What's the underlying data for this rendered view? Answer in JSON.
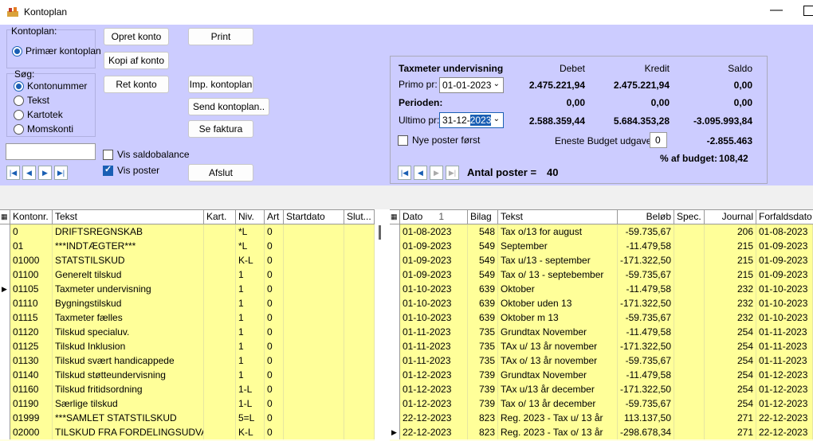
{
  "window": {
    "title": "Kontoplan"
  },
  "left_panel": {
    "kontoplan_label": "Kontoplan:",
    "kontoplan_option": "Primær kontoplan",
    "search_label": "Søg:",
    "search_options": [
      "Kontonummer",
      "Tekst",
      "Kartotek",
      "Momskonti"
    ],
    "vis_saldobalance": "Vis saldobalance",
    "vis_poster": "Vis poster"
  },
  "buttons": {
    "opret": "Opret konto",
    "kopi": "Kopi af konto",
    "ret": "Ret konto",
    "print": "Print",
    "imp": "Imp. kontoplan",
    "send": "Send kontoplan..",
    "faktura": "Se faktura",
    "afslut": "Afslut"
  },
  "info": {
    "title": "Taxmeter undervisning",
    "col_debet": "Debet",
    "col_kredit": "Kredit",
    "col_saldo": "Saldo",
    "primo_label": "Primo pr:",
    "primo_date": "01-01-2023",
    "primo_debet": "2.475.221,94",
    "primo_kredit": "2.475.221,94",
    "primo_saldo": "0,00",
    "perioden_label": "Perioden:",
    "perioden_debet": "0,00",
    "perioden_kredit": "0,00",
    "perioden_saldo": "0,00",
    "ultimo_label": "Ultimo pr:",
    "ultimo_date_a": "31-12-",
    "ultimo_date_b": "2023",
    "ultimo_debet": "2.588.359,44",
    "ultimo_kredit": "5.684.353,28",
    "ultimo_saldo": "-3.095.993,84",
    "nye_poster": "Nye poster først",
    "budget_label": "Eneste Budget udgave:",
    "budget_value": "0",
    "budget_amount": "-2.855.463",
    "pct_label": "% af budget:",
    "pct_value": "108,42",
    "antal_label": "Antal poster =",
    "antal_value": "40"
  },
  "accounts_table": {
    "headers": [
      "Kontonr.",
      "Tekst",
      "Kart.",
      "Niv.",
      "Art",
      "Startdato",
      "Slut..."
    ],
    "rows": [
      [
        "0",
        "DRIFTSREGNSKAB",
        "",
        "*L",
        "0",
        "",
        ""
      ],
      [
        "01",
        "***INDTÆGTER***",
        "",
        "*L",
        "0",
        "",
        ""
      ],
      [
        "01000",
        "STATSTILSKUD",
        "",
        "K-L",
        "0",
        "",
        ""
      ],
      [
        "01100",
        "Generelt tilskud",
        "",
        "1",
        "0",
        "",
        ""
      ],
      [
        "01105",
        "Taxmeter undervisning",
        "",
        "1",
        "0",
        "",
        ""
      ],
      [
        "01110",
        "Bygningstilskud",
        "",
        "1",
        "0",
        "",
        ""
      ],
      [
        "01115",
        "Taxmeter fælles",
        "",
        "1",
        "0",
        "",
        ""
      ],
      [
        "01120",
        "Tilskud specialuv.",
        "",
        "1",
        "0",
        "",
        ""
      ],
      [
        "01125",
        "Tilskud Inklusion",
        "",
        "1",
        "0",
        "",
        ""
      ],
      [
        "01130",
        "Tilskud svært handicappede",
        "",
        "1",
        "0",
        "",
        ""
      ],
      [
        "01140",
        "Tilskud støtteundervisning",
        "",
        "1",
        "0",
        "",
        ""
      ],
      [
        "01160",
        "Tilskud fritidsordning",
        "",
        "1-L",
        "0",
        "",
        ""
      ],
      [
        "01190",
        "Særlige tilskud",
        "",
        "1-L",
        "0",
        "",
        ""
      ],
      [
        "01999",
        "***SAMLET STATSTILSKUD",
        "",
        "5=L",
        "0",
        "",
        ""
      ],
      [
        "02000",
        "TILSKUD FRA FORDELINGSUDVAL...",
        "",
        "K-L",
        "0",
        "",
        ""
      ]
    ]
  },
  "postings_table": {
    "headers": [
      "Dato",
      "Bilag",
      "Tekst",
      "Beløb",
      "Spec.",
      "Journal",
      "Forfaldsdato"
    ],
    "sort_marker": "1",
    "rows": [
      [
        "01-08-2023",
        "548",
        "Tax o/13 for august",
        "-59.735,67",
        "",
        "206",
        "01-08-2023"
      ],
      [
        "01-09-2023",
        "549",
        "September",
        "-11.479,58",
        "",
        "215",
        "01-09-2023"
      ],
      [
        "01-09-2023",
        "549",
        "Tax u/13 - september",
        "-171.322,50",
        "",
        "215",
        "01-09-2023"
      ],
      [
        "01-09-2023",
        "549",
        "Tax o/ 13 - septebember",
        "-59.735,67",
        "",
        "215",
        "01-09-2023"
      ],
      [
        "01-10-2023",
        "639",
        "Oktober",
        "-11.479,58",
        "",
        "232",
        "01-10-2023"
      ],
      [
        "01-10-2023",
        "639",
        "Oktober uden 13",
        "-171.322,50",
        "",
        "232",
        "01-10-2023"
      ],
      [
        "01-10-2023",
        "639",
        "Oktober m 13",
        "-59.735,67",
        "",
        "232",
        "01-10-2023"
      ],
      [
        "01-11-2023",
        "735",
        "Grundtax November",
        "-11.479,58",
        "",
        "254",
        "01-11-2023"
      ],
      [
        "01-11-2023",
        "735",
        "TAx u/ 13 år november",
        "-171.322,50",
        "",
        "254",
        "01-11-2023"
      ],
      [
        "01-11-2023",
        "735",
        "TAx o/ 13 år november",
        "-59.735,67",
        "",
        "254",
        "01-11-2023"
      ],
      [
        "01-12-2023",
        "739",
        "Grundtax November",
        "-11.479,58",
        "",
        "254",
        "01-12-2023"
      ],
      [
        "01-12-2023",
        "739",
        "TAx u/13 år december",
        "-171.322,50",
        "",
        "254",
        "01-12-2023"
      ],
      [
        "01-12-2023",
        "739",
        "Tax o/ 13 år december",
        "-59.735,67",
        "",
        "254",
        "01-12-2023"
      ],
      [
        "22-12-2023",
        "823",
        "Reg. 2023 - Tax u/ 13 år",
        "113.137,50",
        "",
        "271",
        "22-12-2023"
      ],
      [
        "22-12-2023",
        "823",
        "Reg. 2023 - Tax o/ 13 år",
        "-298.678,34",
        "",
        "271",
        "22-12-2023"
      ]
    ]
  }
}
